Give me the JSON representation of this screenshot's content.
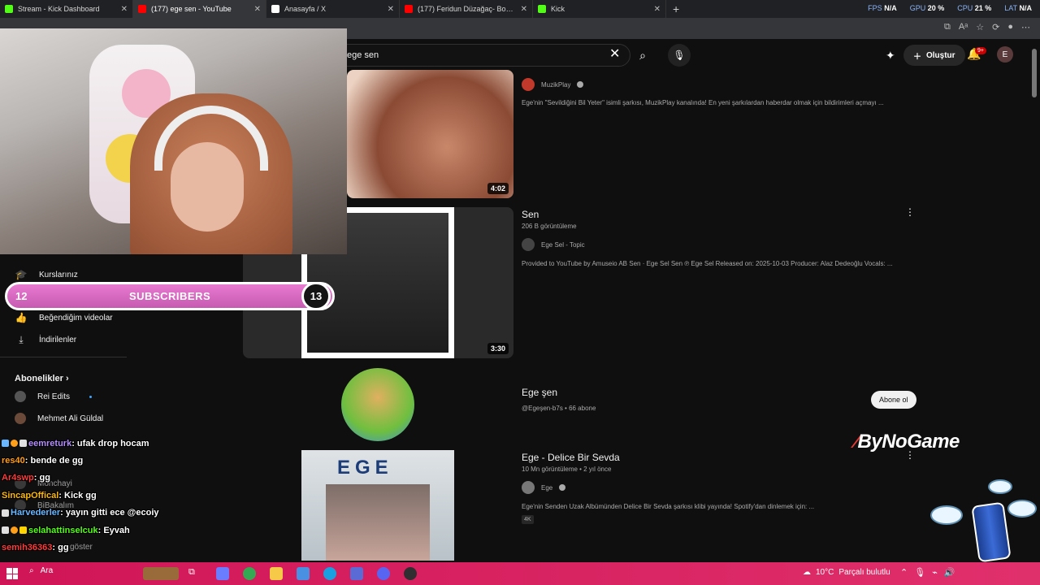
{
  "browser": {
    "tabs": [
      {
        "title": "Stream - Kick Dashboard",
        "favicon_color": "#53fc18",
        "active": false
      },
      {
        "title": "(177) ege sen - YouTube",
        "favicon_color": "#ff0000",
        "active": true
      },
      {
        "title": "Anasayfa / X",
        "favicon_color": "#ffffff",
        "active": false
      },
      {
        "title": "(177) Feridun Düzağaç- Boş Ders",
        "favicon_color": "#ff0000",
        "active": false
      },
      {
        "title": "Kick",
        "favicon_color": "#53fc18",
        "active": false
      }
    ],
    "new_tab": "+",
    "stats": {
      "fps_label": "FPS",
      "fps_value": "N/A",
      "gpu_label": "GPU",
      "gpu_value": "20 %",
      "cpu_label": "CPU",
      "cpu_value": "21 %",
      "lat_label": "LAT",
      "lat_value": "N/A"
    }
  },
  "youtube": {
    "search_value": "ege sen",
    "create_label": "Oluştur",
    "notif_count": "9+",
    "avatar_letter": "E",
    "sidebar": {
      "items": [
        {
          "label": "Kurslarınız",
          "icon": "graduation-cap-icon"
        },
        {
          "label": "Beğendiğim videolar",
          "icon": "thumbs-up-icon"
        },
        {
          "label": "İndirilenler",
          "icon": "download-icon"
        }
      ],
      "subscriptions_heading": "Abonelikler",
      "subscriptions": [
        {
          "name": "Rei Edits",
          "new": true
        },
        {
          "name": "Mehmet Ali Güldal",
          "new": false
        },
        {
          "name": "Monchayi",
          "new": false
        },
        {
          "name": "BiBakalım",
          "new": false
        }
      ],
      "show_more": "göster"
    },
    "results": [
      {
        "type": "video",
        "duration": "4:02",
        "channel": "MuzikPlay",
        "verified": true,
        "description": "Ege'nin \"Sevildiğini Bil Yeter\" isimli şarkısı, MuzikPlay kanalında! En yeni şarkılardan haberdar olmak için bildirimleri açmayı ..."
      },
      {
        "type": "video",
        "title": "Sen",
        "views": "206 B görüntüleme",
        "duration": "3:30",
        "channel": "Ege Sel - Topic",
        "description": "Provided to YouTube by Amuseio AB Sen · Ege Sel Sen ℗ Ege Sel Released on: 2025-10-03 Producer: Alaz Dedeoğlu Vocals: ..."
      },
      {
        "type": "channel",
        "title": "Ege şen",
        "meta": "@Egeşen-b7s • 66 abone",
        "subscribe_label": "Abone ol"
      },
      {
        "type": "video",
        "title": "Ege - Delice Bir Sevda",
        "views": "10 Mn görüntüleme • 2 yıl önce",
        "channel": "Ege",
        "verified": true,
        "description": "Ege'nin Senden Uzak Albümünden Delice Bir Sevda şarkısı klibi yayında! Spotify'dan dinlemek için: ...",
        "badge": "4K",
        "thumb_text": "EGE"
      }
    ]
  },
  "overlay": {
    "subscriber_goal": {
      "current": "12",
      "label": "SUBSCRIBERS",
      "target": "13"
    },
    "watermark": "ByNoGame",
    "chat": [
      {
        "user": "eemreturk",
        "message": ": ufak drop hocam",
        "color": "#b38cff"
      },
      {
        "user": "res40",
        "message": ": bende de gg",
        "color": "#ff9f1a"
      },
      {
        "user": "Ar4swp",
        "message": ": gg",
        "color": "#ff3b3b"
      },
      {
        "user": "SincapOffical",
        "message": ": Kick gg",
        "color": "#ffb800"
      },
      {
        "user": "Harvederler",
        "message": ": yayın gitti ece @ecoiy",
        "color": "#6ab7ff"
      },
      {
        "user": "selahattinselcuk",
        "message": ": Eyvah",
        "color": "#53fc18"
      },
      {
        "user": "semih36363",
        "message": ": gg",
        "color": "#ff3b3b"
      }
    ]
  },
  "taskbar": {
    "search_label": "Ara",
    "weather_temp": "10°C",
    "weather_desc": "Parçalı bulutlu"
  }
}
